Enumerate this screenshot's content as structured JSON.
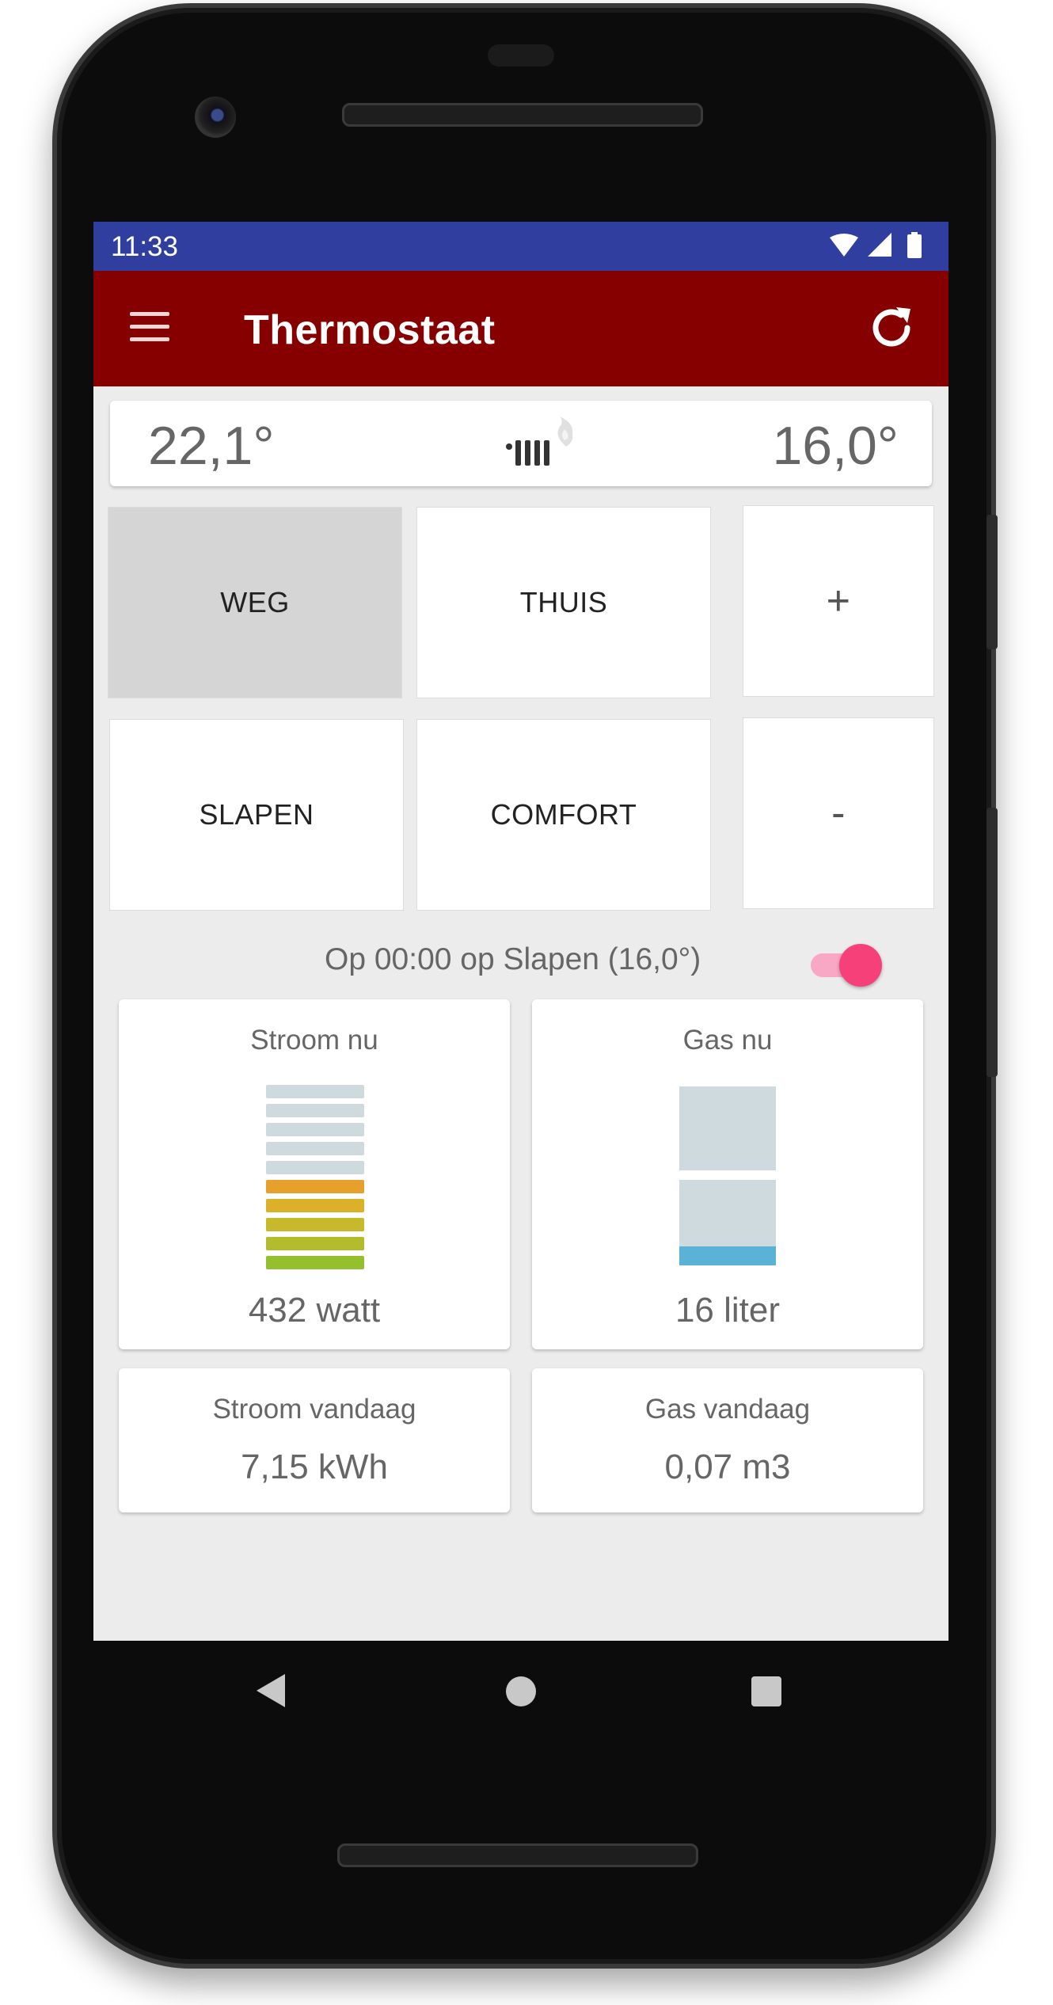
{
  "status_bar": {
    "time": "11:33",
    "icons": [
      "wifi-icon",
      "signal-icon",
      "battery-icon"
    ]
  },
  "app_bar": {
    "title": "Thermostaat",
    "menu_icon": "menu-icon",
    "refresh_icon": "refresh-icon",
    "color": "#870000"
  },
  "temperature": {
    "current": "22,1°",
    "target": "16,0°",
    "heater_icon": "radiator-flame-icon"
  },
  "modes": {
    "weg": "WEG",
    "thuis": "THUIS",
    "slapen": "SLAPEN",
    "comfort": "COMFORT",
    "active": "WEG",
    "plus": "+",
    "minus": "-"
  },
  "schedule": {
    "text": "Op 00:00 op Slapen (16,0°)",
    "enabled": true
  },
  "power_now": {
    "title": "Stroom nu",
    "value": "432 watt",
    "bars_total": 10,
    "bars_lit": 5,
    "lit_colors": [
      "#e8a02c",
      "#dcb12a",
      "#c8b82c",
      "#b3bc2c",
      "#93c02c"
    ],
    "unlit_color": "#cfdadf"
  },
  "gas_now": {
    "title": "Gas nu",
    "value": "16 liter",
    "fill_color": "#5ab2d6"
  },
  "power_today": {
    "title": "Stroom vandaag",
    "value": "7,15 kWh"
  },
  "gas_today": {
    "title": "Gas vandaag",
    "value": "0,07 m3"
  },
  "navigation": {
    "back": "back-icon",
    "home": "home-icon",
    "recents": "recents-icon"
  }
}
